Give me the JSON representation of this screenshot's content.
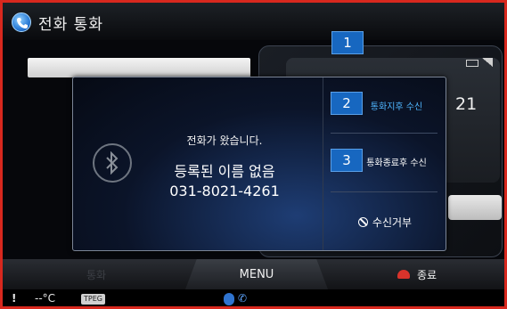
{
  "window": {
    "title": "전화 통화"
  },
  "background": {
    "number_fragment": "21"
  },
  "popup": {
    "message": "전화가 왔습니다.",
    "caller_name": "등록된 이름 없음",
    "caller_number": "031-8021-4261",
    "options": {
      "hold_accept": "통화지후 수신",
      "end_accept": "통화종료후 수신",
      "reject": "수신거부"
    }
  },
  "callouts": [
    "1",
    "2",
    "3"
  ],
  "bottombar": {
    "call_label": "통화",
    "menu_label": "MENU",
    "end_label": "종료"
  },
  "statusbar": {
    "warning": "!",
    "temperature": "--°C",
    "tpeg_label": "TPEG"
  },
  "colors": {
    "frame_border": "#d8281e",
    "highlight_text": "#4fb6ff",
    "callout_bg": "#1767c0",
    "end_icon": "#d8332b"
  }
}
